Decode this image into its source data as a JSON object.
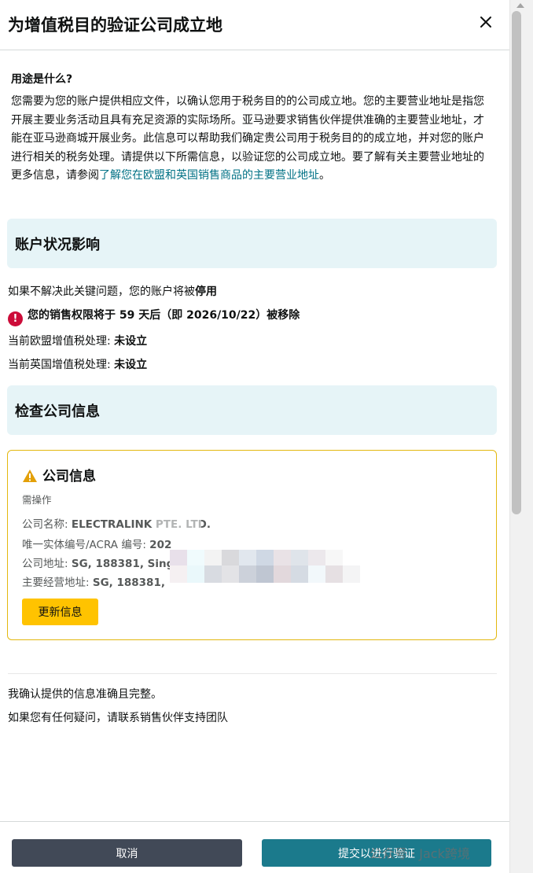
{
  "dialog": {
    "title": "为增值税目的验证公司成立地"
  },
  "purpose": {
    "heading": "用途是什么?",
    "text": "您需要为您的账户提供相应文件，以确认您用于税务目的的公司成立地。您的主要营业地址是指您开展主要业务活动且具有充足资源的实际场所。亚马逊要求销售伙伴提供准确的主要营业地址，才能在亚马逊商城开展业务。此信息可以帮助我们确定贵公司用于税务目的的成立地，并对您的账户进行相关的税务处理。请提供以下所需信息，以验证您的公司成立地。要了解有关主要营业地址的更多信息，请参阅",
    "link": "了解您在欧盟和英国销售商品的主要营业地址",
    "end": "。"
  },
  "account_impact": {
    "heading": "账户状况影响",
    "warning_prefix": "如果不解决此关键问题，您的账户将被",
    "warning_bold": "停用",
    "removal_notice": "您的销售权限将于 59 天后（即 2026/10/22）被移除",
    "eu_vat_label": "当前欧盟增值税处理: ",
    "eu_vat_value": "未设立",
    "uk_vat_label": "当前英国增值税处理: ",
    "uk_vat_value": "未设立"
  },
  "check_company": {
    "heading": "检查公司信息"
  },
  "company_card": {
    "title": "公司信息",
    "status": "需操作",
    "name_label": "公司名称: ",
    "name_value": "ELECTRALINK PTE. LTD.",
    "uen_label": "唯一实体编号/ACRA 编号: ",
    "uen_value": "202",
    "address_label": "公司地址: ",
    "address_value": "SG, 188381, Sing",
    "main_address_label": "主要经营地址: ",
    "main_address_value": "SG, 188381,",
    "update_button": "更新信息"
  },
  "confirm_text": "我确认提供的信息准确且完整。",
  "contact_text": "如果您有任何疑问，请联系销售伙伴支持团队",
  "footer": {
    "cancel": "取消",
    "submit": "提交以进行验证"
  },
  "watermark": "公众号 · Jack跨境",
  "colors": {
    "accent_teal": "#007185",
    "error_red": "#cc0c39",
    "warning_yellow": "#ffc300",
    "banner_bg": "#e6f4f7"
  }
}
